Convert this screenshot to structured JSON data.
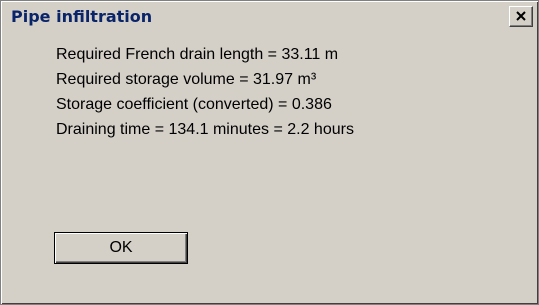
{
  "window": {
    "title": "Pipe infiltration",
    "close_icon": "close-icon"
  },
  "results": {
    "french_drain_length": "Required French drain length = 33.11 m",
    "storage_volume": "Required storage volume = 31.97 m³",
    "storage_coefficient": "Storage coefficient (converted) = 0.386",
    "draining_time": "Draining time = 134.1 minutes = 2.2 hours"
  },
  "buttons": {
    "ok_label": "OK"
  },
  "colors": {
    "dialog_background": "#d4d0c8",
    "title_text": "#0a246a"
  }
}
